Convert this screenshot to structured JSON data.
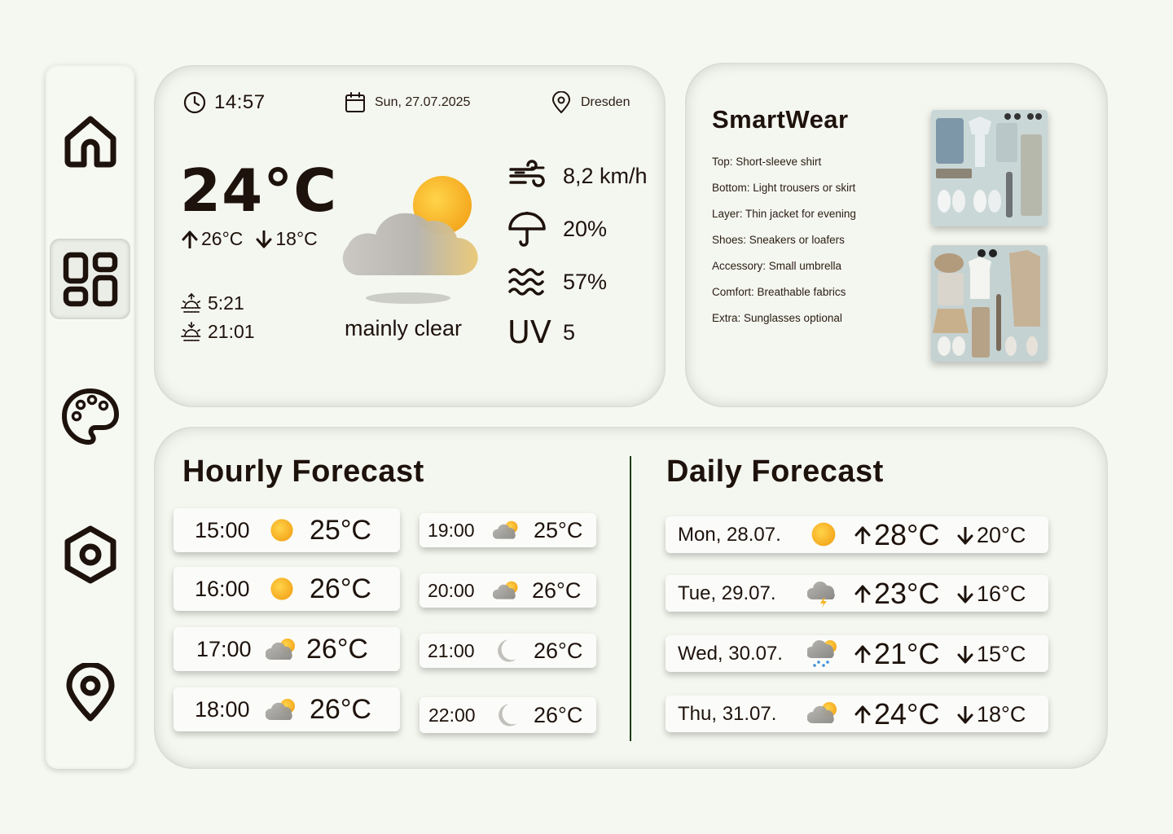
{
  "sidebar": {
    "items": [
      {
        "icon": "home-icon",
        "active": false
      },
      {
        "icon": "dashboard-icon",
        "active": true
      },
      {
        "icon": "palette-icon",
        "active": false
      },
      {
        "icon": "settings-icon",
        "active": false
      },
      {
        "icon": "location-pin-icon",
        "active": false
      }
    ]
  },
  "current": {
    "time": "14:57",
    "date": "Sun, 27.07.2025",
    "location": "Dresden",
    "temperature": "24°C",
    "high": "26°C",
    "low": "18°C",
    "sunrise": "5:21",
    "sunset": "21:01",
    "condition": "mainly clear",
    "wind": "8,2 km/h",
    "precipitation": "20%",
    "humidity": "57%",
    "uv_label": "UV",
    "uv_value": "5"
  },
  "smartwear": {
    "title": "SmartWear",
    "items": [
      "Top: Short-sleeve shirt",
      "Bottom: Light trousers or skirt",
      "Layer: Thin jacket for evening",
      "Shoes: Sneakers or loafers",
      "Accessory: Small umbrella",
      "Comfort: Breathable fabrics",
      "Extra: Sunglasses optional"
    ]
  },
  "hourly": {
    "title": "Hourly Forecast",
    "left": [
      {
        "time": "15:00",
        "temp": "25°C",
        "icon": "sun-icon"
      },
      {
        "time": "16:00",
        "temp": "26°C",
        "icon": "sun-icon"
      },
      {
        "time": "17:00",
        "temp": "26°C",
        "icon": "partly-cloudy-icon"
      },
      {
        "time": "18:00",
        "temp": "26°C",
        "icon": "partly-cloudy-icon"
      }
    ],
    "right": [
      {
        "time": "19:00",
        "temp": "25°C",
        "icon": "partly-cloudy-icon"
      },
      {
        "time": "20:00",
        "temp": "26°C",
        "icon": "partly-cloudy-icon"
      },
      {
        "time": "21:00",
        "temp": "26°C",
        "icon": "moon-icon"
      },
      {
        "time": "22:00",
        "temp": "26°C",
        "icon": "moon-icon"
      }
    ]
  },
  "daily": {
    "title": "Daily Forecast",
    "days": [
      {
        "day": "Mon, 28.07.",
        "high": "28°C",
        "low": "20°C",
        "icon": "sun-icon"
      },
      {
        "day": "Tue, 29.07.",
        "high": "23°C",
        "low": "16°C",
        "icon": "thunderstorm-icon"
      },
      {
        "day": "Wed, 30.07.",
        "high": "21°C",
        "low": "15°C",
        "icon": "rain-sun-icon"
      },
      {
        "day": "Thu, 31.07.",
        "high": "24°C",
        "low": "18°C",
        "icon": "partly-cloudy-icon"
      }
    ]
  },
  "colors": {
    "background": "#f5f8f1",
    "text": "#1e120c",
    "sun": "#f7b530",
    "divider": "#1e3f18"
  }
}
